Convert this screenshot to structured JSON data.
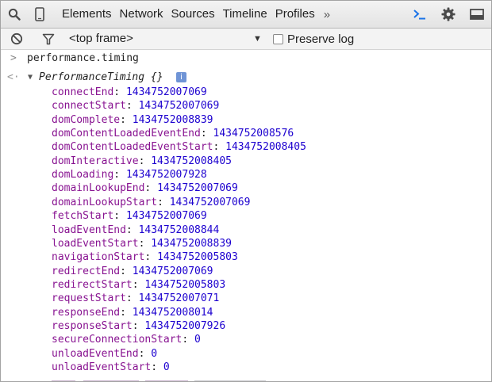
{
  "toolbar": {
    "tabs": [
      "Elements",
      "Network",
      "Sources",
      "Timeline",
      "Profiles"
    ],
    "more_glyph": "»",
    "icons": [
      "search-icon",
      "device-mode-icon",
      "drawer-console-icon",
      "gear-icon",
      "dock-icon"
    ]
  },
  "filterbar": {
    "frame_label": "<top frame>",
    "preserve_log": "Preserve log",
    "preserve_checked": false
  },
  "console": {
    "command": "performance.timing",
    "result_name": "PerformanceTiming {}",
    "info_glyph": "i",
    "properties": [
      {
        "key": "connectEnd",
        "value": "1434752007069"
      },
      {
        "key": "connectStart",
        "value": "1434752007069"
      },
      {
        "key": "domComplete",
        "value": "1434752008839"
      },
      {
        "key": "domContentLoadedEventEnd",
        "value": "1434752008576"
      },
      {
        "key": "domContentLoadedEventStart",
        "value": "1434752008405"
      },
      {
        "key": "domInteractive",
        "value": "1434752008405"
      },
      {
        "key": "domLoading",
        "value": "1434752007928"
      },
      {
        "key": "domainLookupEnd",
        "value": "1434752007069"
      },
      {
        "key": "domainLookupStart",
        "value": "1434752007069"
      },
      {
        "key": "fetchStart",
        "value": "1434752007069"
      },
      {
        "key": "loadEventEnd",
        "value": "1434752008844"
      },
      {
        "key": "loadEventStart",
        "value": "1434752008839"
      },
      {
        "key": "navigationStart",
        "value": "1434752005803"
      },
      {
        "key": "redirectEnd",
        "value": "1434752007069"
      },
      {
        "key": "redirectStart",
        "value": "1434752005803"
      },
      {
        "key": "requestStart",
        "value": "1434752007071"
      },
      {
        "key": "responseEnd",
        "value": "1434752008014"
      },
      {
        "key": "responseStart",
        "value": "1434752007926"
      },
      {
        "key": "secureConnectionStart",
        "value": "0"
      },
      {
        "key": "unloadEventEnd",
        "value": "0"
      },
      {
        "key": "unloadEventStart",
        "value": "0"
      }
    ]
  },
  "colors": {
    "accent": "#1a73e8",
    "prop_key": "#881391",
    "prop_value": "#1c00cf",
    "info_badge": "#6f94d6"
  }
}
